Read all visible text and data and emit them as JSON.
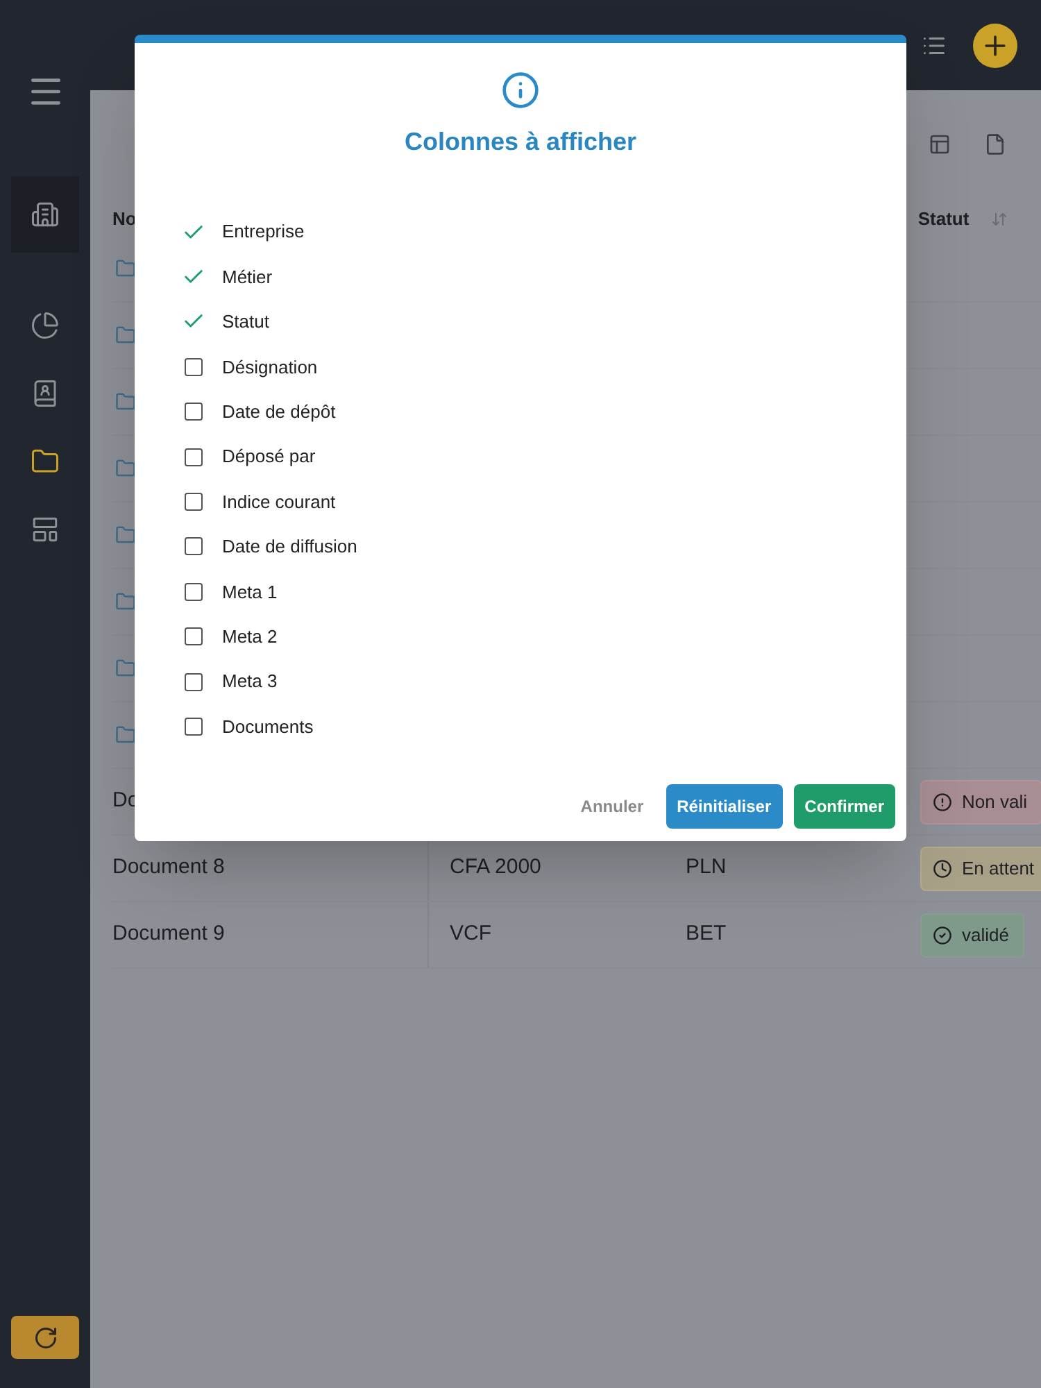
{
  "sidebar": {
    "items": [
      {
        "kind": "company",
        "selected": false,
        "highlighted": true
      },
      {
        "kind": "dashboard",
        "selected": false,
        "highlighted": false
      },
      {
        "kind": "contacts",
        "selected": false,
        "highlighted": false
      },
      {
        "kind": "documents",
        "selected": true,
        "highlighted": false
      },
      {
        "kind": "plans",
        "selected": false,
        "highlighted": false
      }
    ]
  },
  "table": {
    "columns": [
      {
        "label": "No"
      },
      {
        "label": "Statut",
        "sortable": true
      }
    ],
    "rows": [
      {
        "kind": "folder"
      },
      {
        "kind": "folder"
      },
      {
        "kind": "folder"
      },
      {
        "kind": "folder"
      },
      {
        "kind": "folder"
      },
      {
        "kind": "folder"
      },
      {
        "kind": "folder"
      },
      {
        "kind": "folder"
      },
      {
        "kind": "document",
        "name": "Do",
        "status": {
          "label": "Non vali",
          "kind": "error"
        }
      },
      {
        "kind": "document",
        "name": "Document 8",
        "column_2": "CFA 2000",
        "column_3": "PLN",
        "status": {
          "label": "En attent",
          "kind": "pending"
        }
      },
      {
        "kind": "document",
        "name": "Document 9",
        "column_2": "VCF",
        "column_3": "BET",
        "status": {
          "label": "validé",
          "kind": "valid"
        }
      }
    ]
  },
  "modal": {
    "title": "Colonnes à afficher",
    "options": [
      {
        "label": "Entreprise",
        "checked": true
      },
      {
        "label": "Métier",
        "checked": true
      },
      {
        "label": "Statut",
        "checked": true
      },
      {
        "label": "Désignation",
        "checked": false
      },
      {
        "label": "Date de dépôt",
        "checked": false
      },
      {
        "label": "Déposé par",
        "checked": false
      },
      {
        "label": "Indice courant",
        "checked": false
      },
      {
        "label": "Date de diffusion",
        "checked": false
      },
      {
        "label": "Meta 1",
        "checked": false
      },
      {
        "label": "Meta 2",
        "checked": false
      },
      {
        "label": "Meta 3",
        "checked": false
      },
      {
        "label": "Documents",
        "checked": false
      }
    ],
    "buttons": [
      {
        "label": "Annuler",
        "kind": "cancel"
      },
      {
        "label": "Réinitialiser",
        "kind": "reset"
      },
      {
        "label": "Confirmer",
        "kind": "confirm"
      }
    ]
  }
}
